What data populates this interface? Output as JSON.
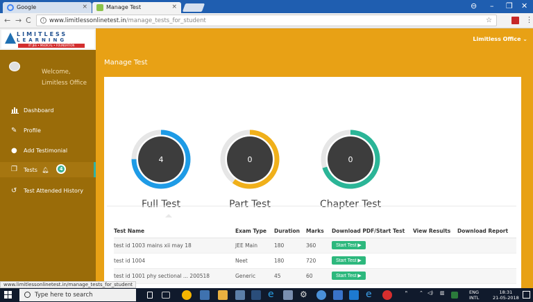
{
  "browser": {
    "tabs": [
      {
        "label": "Google",
        "close": "×"
      },
      {
        "label": "Manage Test",
        "close": "×"
      }
    ],
    "url_host": "www.limitlessonlinetest.in",
    "url_path": "/manage_tests_for_student",
    "status_url": "www.limitlessonlinetest.in/manage_tests_for_student",
    "window_controls": {
      "user": "⊖",
      "min": "–",
      "max": "❐",
      "close": "✕"
    },
    "nav": {
      "back": "←",
      "forward": "→",
      "reload": "C"
    }
  },
  "header": {
    "logo_top": "LIMITLESS",
    "logo_mid": "LEARNING",
    "logo_sub": "IIT JEE • MEDICAL • FOUNDATION",
    "user_menu": "Limitless Office ⌄"
  },
  "sidebar": {
    "welcome": "Welcome,",
    "username": "Limitless Office",
    "items": [
      {
        "label": "Dashboard",
        "icon": "bar-chart-icon"
      },
      {
        "label": "Profile",
        "icon": "edit-icon"
      },
      {
        "label": "Add Testimonial",
        "icon": "comment-icon"
      },
      {
        "label": "Tests",
        "icon": "copy-icon",
        "badge": "4"
      },
      {
        "label": "Test Attended History",
        "icon": "history-icon"
      }
    ]
  },
  "main": {
    "title": "Manage Test",
    "stats": [
      {
        "label": "Full Test",
        "value": "4",
        "color": "#1e9be6",
        "fraction": 0.75
      },
      {
        "label": "Part Test",
        "value": "0",
        "color": "#f0b01a",
        "fraction": 0.6
      },
      {
        "label": "Chapter Test",
        "value": "0",
        "color": "#2bb597",
        "fraction": 0.7
      }
    ],
    "table": {
      "headers": [
        "Test Name",
        "Exam Type",
        "Duration",
        "Marks",
        "Download PDF/Start Test",
        "View Results",
        "Download Report"
      ],
      "rows": [
        {
          "name": "test id 1003 mains xii may 18",
          "exam": "JEE Main",
          "duration": "180",
          "marks": "360",
          "action": "Start Test ▶"
        },
        {
          "name": "test id 1004",
          "exam": "Neet",
          "duration": "180",
          "marks": "720",
          "action": "Start Test ▶"
        },
        {
          "name": "test id 1001 phy sectional ... 200518",
          "exam": "Generic",
          "duration": "45",
          "marks": "60",
          "action": "Start Test ▶"
        }
      ]
    }
  },
  "taskbar": {
    "search_placeholder": "Type here to search",
    "lang": "ENG",
    "layout": "INTL",
    "time": "18:31",
    "date": "21-05-2018"
  }
}
